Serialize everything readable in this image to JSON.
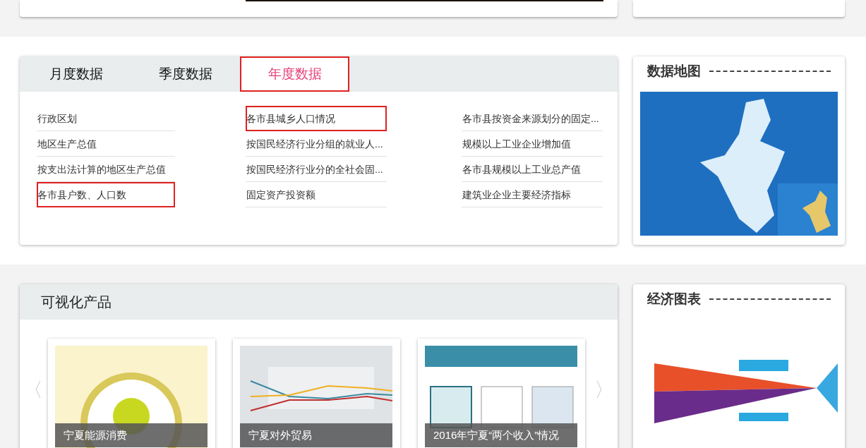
{
  "data_panel": {
    "tabs": [
      {
        "label": "月度数据",
        "selected": false,
        "highlighted": false
      },
      {
        "label": "季度数据",
        "selected": false,
        "highlighted": false
      },
      {
        "label": "年度数据",
        "selected": true,
        "highlighted": true
      }
    ],
    "columns": [
      [
        {
          "label": "行政区划",
          "highlighted": false
        },
        {
          "label": "地区生产总值",
          "highlighted": false
        },
        {
          "label": "按支出法计算的地区生产总值",
          "highlighted": false
        },
        {
          "label": "各市县户数、人口数",
          "highlighted": true
        }
      ],
      [
        {
          "label": "各市县城乡人口情况",
          "highlighted": true
        },
        {
          "label": "按国民经济行业分组的就业人...",
          "highlighted": false
        },
        {
          "label": "按国民经济行业分的全社会固...",
          "highlighted": false
        },
        {
          "label": "固定资产投资额",
          "highlighted": false
        }
      ],
      [
        {
          "label": "各市县按资金来源划分的固定...",
          "highlighted": false
        },
        {
          "label": "规模以上工业企业增加值",
          "highlighted": false
        },
        {
          "label": "各市县规模以上工业总产值",
          "highlighted": false
        },
        {
          "label": "建筑业企业主要经济指标",
          "highlighted": false
        }
      ]
    ]
  },
  "map_panel": {
    "title": "数据地图"
  },
  "products_panel": {
    "title": "可视化产品",
    "prev": "〈",
    "next": "〉",
    "cards": [
      {
        "kind": "energy",
        "caption": "宁夏能源消费"
      },
      {
        "kind": "trade",
        "caption": "宁夏对外贸易"
      },
      {
        "kind": "gdp",
        "caption": "2016年宁夏“两个收入”情况"
      }
    ]
  },
  "charts_panel": {
    "title": "经济图表"
  }
}
